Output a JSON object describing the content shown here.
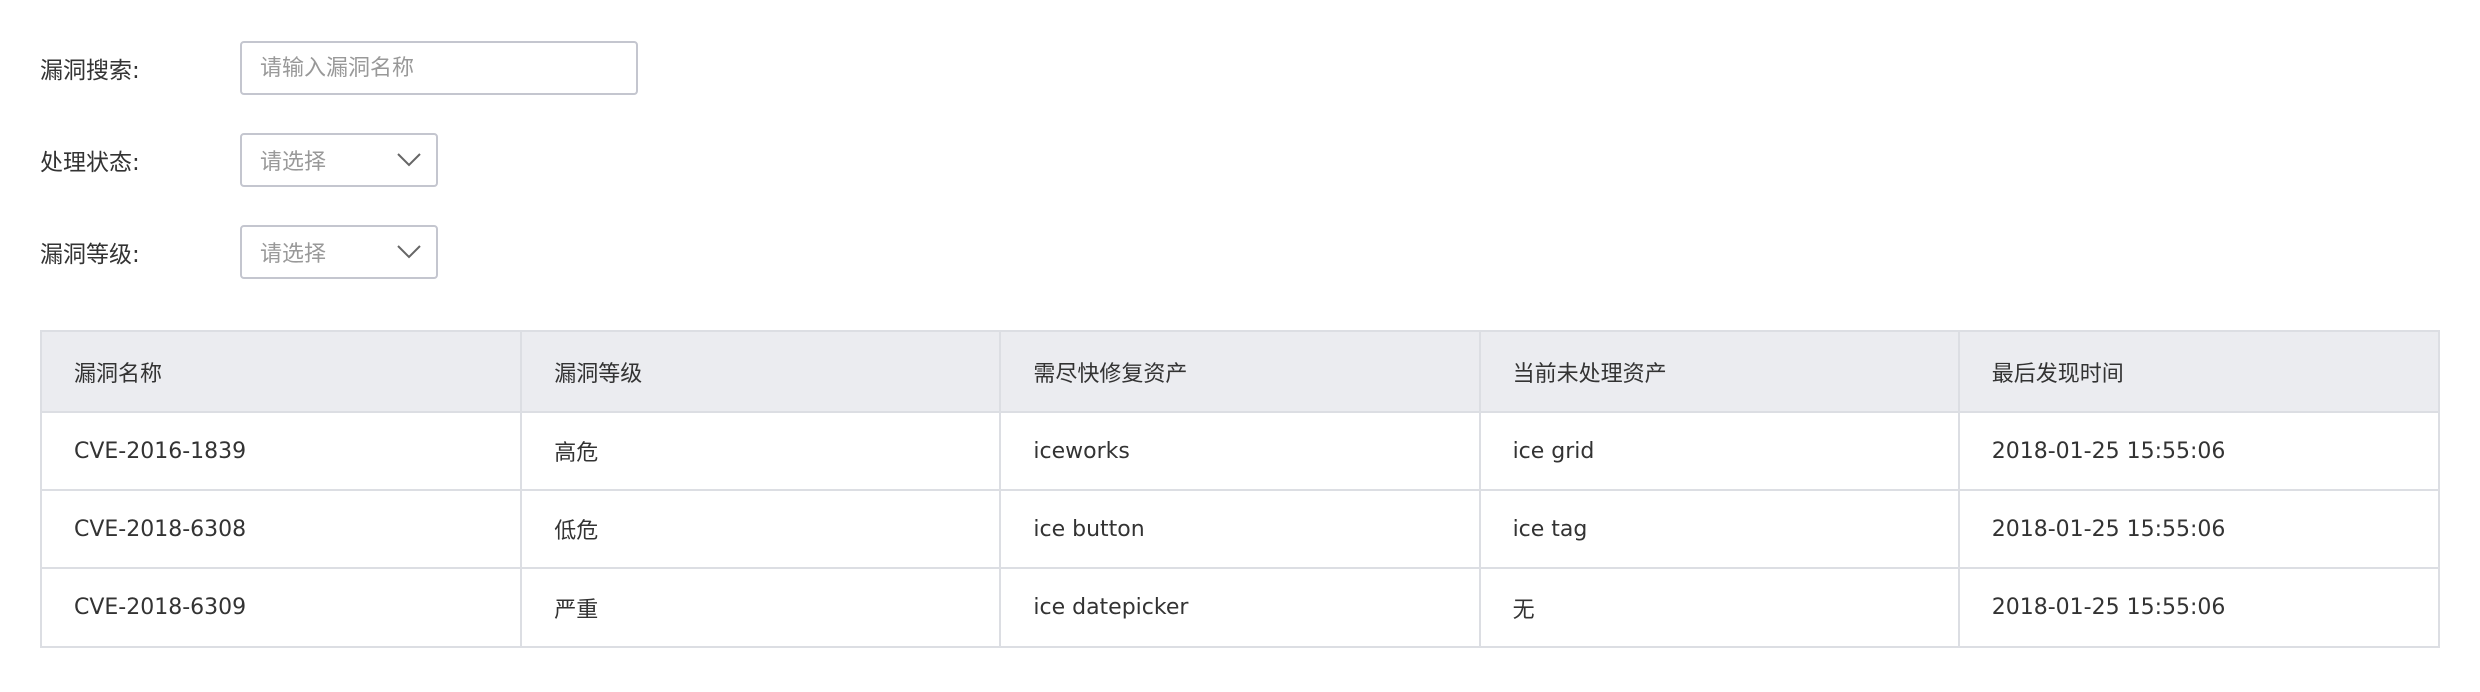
{
  "filters": {
    "search": {
      "label": "漏洞搜索:",
      "placeholder": "请输入漏洞名称",
      "value": ""
    },
    "status": {
      "label": "处理状态:",
      "selected": "请选择"
    },
    "level": {
      "label": "漏洞等级:",
      "selected": "请选择"
    }
  },
  "table": {
    "columns": [
      "漏洞名称",
      "漏洞等级",
      "需尽快修复资产",
      "当前未处理资产",
      "最后发现时间"
    ],
    "rows": [
      [
        "CVE-2016-1839",
        "高危",
        "iceworks",
        "ice grid",
        "2018-01-25 15:55:06"
      ],
      [
        "CVE-2018-6308",
        "低危",
        "ice button",
        "ice tag",
        "2018-01-25 15:55:06"
      ],
      [
        "CVE-2018-6309",
        "严重",
        "ice datepicker",
        "无",
        "2018-01-25 15:55:06"
      ]
    ]
  },
  "colors": {
    "border": "#c4c6cf",
    "header_bg": "#ebecf0",
    "text": "#333333",
    "placeholder": "#999999"
  },
  "icons": {
    "select_arrow": "chevron-down-icon"
  }
}
